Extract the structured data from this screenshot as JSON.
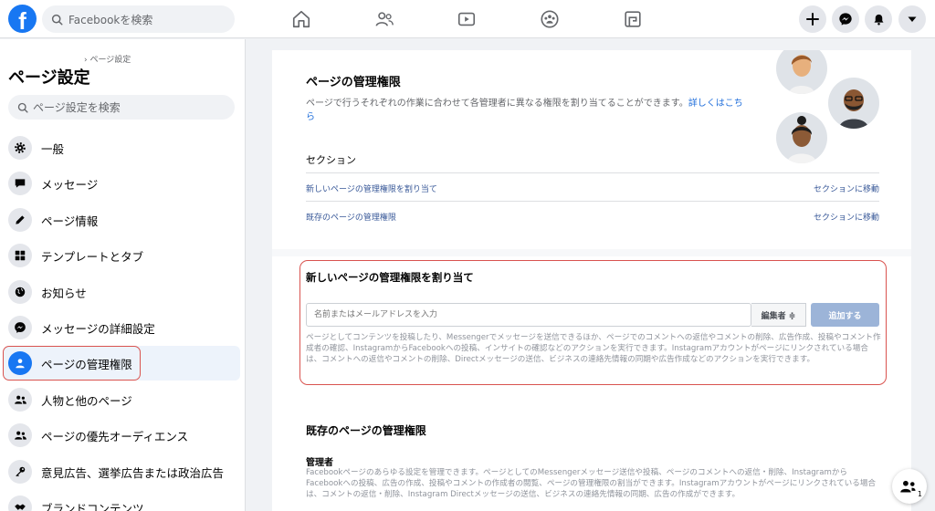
{
  "topbar": {
    "logo_letter": "f",
    "search_placeholder": "Facebookを検索"
  },
  "sidebar": {
    "breadcrumb": "› ページ設定",
    "title": "ページ設定",
    "search_placeholder": "ページ設定を検索",
    "items": [
      {
        "label": "一般",
        "icon": "gear-icon"
      },
      {
        "label": "メッセージ",
        "icon": "chat-bubble-icon"
      },
      {
        "label": "ページ情報",
        "icon": "pencil-icon"
      },
      {
        "label": "テンプレートとタブ",
        "icon": "grid-icon"
      },
      {
        "label": "お知らせ",
        "icon": "globe-icon"
      },
      {
        "label": "メッセージの詳細設定",
        "icon": "messenger-icon"
      },
      {
        "label": "ページの管理権限",
        "icon": "person-icon"
      },
      {
        "label": "人物と他のページ",
        "icon": "people-icon"
      },
      {
        "label": "ページの優先オーディエンス",
        "icon": "people-icon"
      },
      {
        "label": "意見広告、選挙広告または政治広告",
        "icon": "key-icon"
      },
      {
        "label": "ブランドコンテンツ",
        "icon": "handshake-icon"
      }
    ]
  },
  "main": {
    "panel_title": "ページの管理権限",
    "panel_desc": "ページで行うそれぞれの作業に合わせて各管理者に異なる権限を割り当てることができます。",
    "panel_link": "詳しくはこちら",
    "section_label": "セクション",
    "sections": [
      {
        "label": "新しいページの管理権限を割り当て",
        "go": "セクションに移動"
      },
      {
        "label": "既存のページの管理権限",
        "go": "セクションに移動"
      }
    ],
    "assign": {
      "title": "新しいページの管理権限を割り当て",
      "input_placeholder": "名前またはメールアドレスを入力",
      "role": "編集者 ≑",
      "add_button": "追加する",
      "desc": "ページとしてコンテンツを投稿したり、Messengerでメッセージを送信できるほか、ページでのコメントへの返信やコメントの削除、広告作成、投稿やコメント作成者の確認、InstagramからFacebookへの投稿、インサイトの確認などのアクションを実行できます。Instagramアカウントがページにリンクされている場合は、コメントへの返信やコメントの削除、Directメッセージの送信、ビジネスの連絡先情報の同期や広告作成などのアクションを実行できます。"
    },
    "existing_title": "既存のページの管理権限",
    "admin_label": "管理者",
    "admin_desc": "Facebookページのあらゆる設定を管理できます。ページとしてのMessengerメッセージ送信や投稿、ページのコメントへの返信・削除、Instagramから Facebookへの投稿、広告の作成、投稿やコメントの作成者の閲覧、ページの管理権限の割当ができます。Instagramアカウントがページにリンクされている場合は、コメントの返信・削除、Instagram Directメッセージの送信、ビジネスの連絡先情報の同期、広告の作成ができます。"
  },
  "chat_badge": "1"
}
